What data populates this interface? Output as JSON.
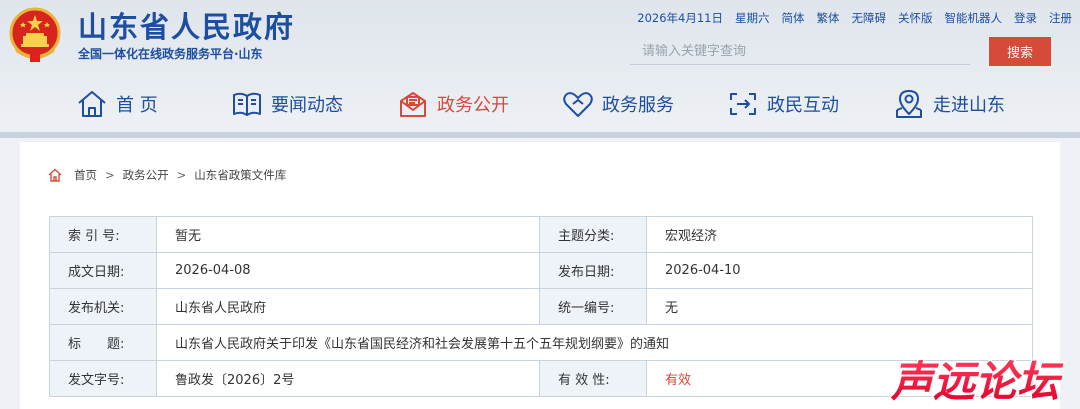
{
  "header": {
    "title": "山东省人民政府",
    "subtitle": "全国一体化在线政务服务平台·山东",
    "topbar": {
      "date": "2026年4月11日",
      "weekday": "星期六",
      "links": [
        "简体",
        "繁体",
        "无障碍",
        "关怀版",
        "智能机器人",
        "登录",
        "注册"
      ]
    },
    "search": {
      "placeholder": "请输入关键字查询",
      "button_label": "搜索"
    },
    "nav": [
      {
        "label": "首 页",
        "icon": "home-icon"
      },
      {
        "label": "要闻动态",
        "icon": "book-icon"
      },
      {
        "label": "政务公开",
        "icon": "mail-icon"
      },
      {
        "label": "政务服务",
        "icon": "heart-icon"
      },
      {
        "label": "政民互动",
        "icon": "interact-icon"
      },
      {
        "label": "走进山东",
        "icon": "location-icon"
      }
    ],
    "active_nav": "政务公开",
    "colors": {
      "brand": "#1d4ea0",
      "accent": "#d64a3a"
    }
  },
  "breadcrumb": [
    "首页",
    "政务公开",
    "山东省政策文件库"
  ],
  "meta": {
    "rows": [
      {
        "l1": "索 引 号:",
        "v1": "暂无",
        "l2": "主题分类:",
        "v2": "宏观经济"
      },
      {
        "l1": "成文日期:",
        "v1": "2026-04-08",
        "l2": "发布日期:",
        "v2": "2026-04-10"
      },
      {
        "l1": "发布机关:",
        "v1": "山东省人民政府",
        "l2": "统一编号:",
        "v2": "无"
      },
      {
        "l1": "标　　题:",
        "v_full": "山东省人民政府关于印发《山东省国民经济和社会发展第十五个五年规划纲要》的通知"
      },
      {
        "l1": "发文字号:",
        "v1": "鲁政发〔2026〕2号",
        "l2": "有 效 性:",
        "v2": "有效"
      }
    ]
  },
  "watermark": "声远论坛"
}
